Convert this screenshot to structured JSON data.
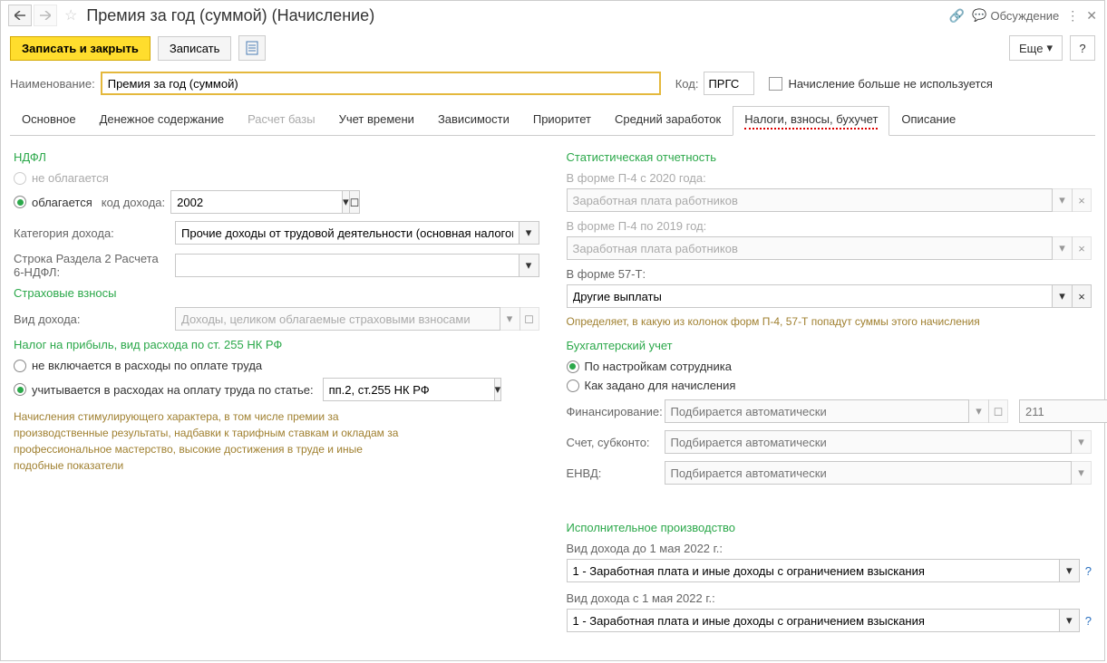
{
  "title": "Премия за год (суммой) (Начисление)",
  "discuss_label": "Обсуждение",
  "toolbar": {
    "save_close": "Записать и закрыть",
    "save": "Записать",
    "more": "Еще"
  },
  "header": {
    "name_label": "Наименование:",
    "name_value": "Премия за год (суммой)",
    "code_label": "Код:",
    "code_value": "ПРГС",
    "not_used": "Начисление больше не используется"
  },
  "tabs": [
    "Основное",
    "Денежное содержание",
    "Расчет базы",
    "Учет времени",
    "Зависимости",
    "Приоритет",
    "Средний заработок",
    "Налоги, взносы, бухучет",
    "Описание"
  ],
  "left": {
    "ndfl_title": "НДФЛ",
    "not_taxed": "не облагается",
    "taxed": "облагается",
    "income_code_label": "код дохода:",
    "income_code": "2002",
    "category_label": "Категория дохода:",
    "category": "Прочие доходы от трудовой деятельности (основная налоговая база)",
    "row2_label": "Строка Раздела 2 Расчета 6-НДФЛ:",
    "row2_value": "",
    "ins_title": "Страховые взносы",
    "income_type_label": "Вид дохода:",
    "income_type": "Доходы, целиком облагаемые страховыми взносами",
    "profit_title": "Налог на прибыль, вид расхода по ст. 255 НК РФ",
    "not_included": "не включается в расходы по оплате труда",
    "included": "учитывается в расходах на оплату труда по статье:",
    "article": "пп.2, ст.255 НК РФ",
    "description": "Начисления стимулирующего характера, в том числе премии за производственные результаты, надбавки к тарифным ставкам и окладам за профессиональное мастерство, высокие достижения в труде и иные подобные показатели"
  },
  "right": {
    "stat_title": "Статистическая отчетность",
    "p4_2020": "В форме П-4 с 2020 года:",
    "p4_2020_val": "Заработная плата работников",
    "p4_2019": "В форме П-4 по 2019 год:",
    "p4_2019_val": "Заработная плата работников",
    "f57t": "В форме 57-Т:",
    "f57t_val": "Другие выплаты",
    "help1": "Определяет, в какую из колонок форм П-4, 57-Т попадут суммы этого начисления",
    "acc_title": "Бухгалтерский учет",
    "by_employee": "По настройкам сотрудника",
    "as_set": "Как задано для начисления",
    "finance_label": "Финансирование:",
    "finance_val": "Подбирается автоматически",
    "acc211": "211",
    "account_label": "Счет, субконто:",
    "account_val": "Подбирается автоматически",
    "envd_label": "ЕНВД:",
    "envd_val": "Подбирается автоматически",
    "exec_title": "Исполнительное производство",
    "before_label": "Вид дохода до 1 мая 2022 г.:",
    "before_val": "1 - Заработная плата и иные доходы с ограничением взыскания",
    "after_label": "Вид дохода с 1 мая 2022 г.:",
    "after_val": "1 - Заработная плата и иные доходы с ограничением взыскания"
  }
}
